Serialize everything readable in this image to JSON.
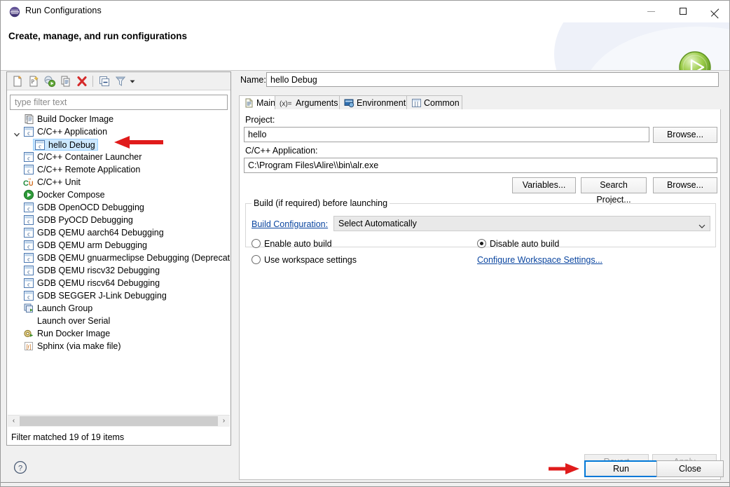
{
  "window": {
    "title": "Run Configurations",
    "icon": "eclipse-icon",
    "minimize_label": "Minimize",
    "maximize_label": "Maximize",
    "close_label": "Close"
  },
  "banner": {
    "title": "Create, manage, and run configurations",
    "badge_icon": "run-green-play-icon"
  },
  "left_panel": {
    "toolbar": [
      {
        "name": "new-launch-configuration-icon",
        "title": "New launch configuration"
      },
      {
        "name": "new-prototype-icon",
        "title": "New prototype"
      },
      {
        "name": "export-icon",
        "title": "Export"
      },
      {
        "name": "duplicate-icon",
        "title": "Duplicate"
      },
      {
        "name": "delete-icon",
        "title": "Delete"
      },
      {
        "name": "collapse-all-icon",
        "title": "Collapse All"
      },
      {
        "name": "filter-icon",
        "title": "Filter launch configurations"
      },
      {
        "name": "view-menu-icon",
        "title": "View Menu"
      }
    ],
    "filter": {
      "placeholder": "type filter text",
      "value": ""
    },
    "tree": [
      {
        "label": "Build Docker Image",
        "icon": "docker-build-icon",
        "indent": 1,
        "selected": false,
        "expander": ""
      },
      {
        "label": "C/C++ Application",
        "icon": "c-file-icon",
        "indent": 1,
        "selected": false,
        "expander": "expanded"
      },
      {
        "label": "hello Debug",
        "icon": "c-file-icon",
        "indent": 2,
        "selected": true,
        "expander": ""
      },
      {
        "label": "C/C++ Container Launcher",
        "icon": "c-file-icon",
        "indent": 1,
        "selected": false,
        "expander": ""
      },
      {
        "label": "C/C++ Remote Application",
        "icon": "c-file-icon",
        "indent": 1,
        "selected": false,
        "expander": ""
      },
      {
        "label": "C/C++ Unit",
        "icon": "cunit-icon",
        "indent": 1,
        "selected": false,
        "expander": ""
      },
      {
        "label": "Docker Compose",
        "icon": "docker-compose-icon",
        "indent": 1,
        "selected": false,
        "expander": ""
      },
      {
        "label": "GDB OpenOCD Debugging",
        "icon": "c-file-icon",
        "indent": 1,
        "selected": false,
        "expander": ""
      },
      {
        "label": "GDB PyOCD Debugging",
        "icon": "c-file-icon",
        "indent": 1,
        "selected": false,
        "expander": ""
      },
      {
        "label": "GDB QEMU aarch64 Debugging",
        "icon": "c-file-icon",
        "indent": 1,
        "selected": false,
        "expander": ""
      },
      {
        "label": "GDB QEMU arm Debugging",
        "icon": "c-file-icon",
        "indent": 1,
        "selected": false,
        "expander": ""
      },
      {
        "label": "GDB QEMU gnuarmeclipse Debugging (Deprecated)",
        "icon": "c-file-icon",
        "indent": 1,
        "selected": false,
        "expander": ""
      },
      {
        "label": "GDB QEMU riscv32 Debugging",
        "icon": "c-file-icon",
        "indent": 1,
        "selected": false,
        "expander": ""
      },
      {
        "label": "GDB QEMU riscv64 Debugging",
        "icon": "c-file-icon",
        "indent": 1,
        "selected": false,
        "expander": ""
      },
      {
        "label": "GDB SEGGER J-Link Debugging",
        "icon": "c-file-icon",
        "indent": 1,
        "selected": false,
        "expander": ""
      },
      {
        "label": "Launch Group",
        "icon": "launch-group-icon",
        "indent": 1,
        "selected": false,
        "expander": ""
      },
      {
        "label": "Launch over Serial",
        "icon": "none",
        "indent": 1,
        "selected": false,
        "expander": ""
      },
      {
        "label": "Run Docker Image",
        "icon": "docker-run-icon",
        "indent": 1,
        "selected": false,
        "expander": ""
      },
      {
        "label": "Sphinx (via make file)",
        "icon": "sphinx-icon",
        "indent": 1,
        "selected": false,
        "expander": ""
      }
    ],
    "scroll_left_glyph": "‹",
    "scroll_right_glyph": "›",
    "status": "Filter matched 19 of 19 items"
  },
  "right_panel": {
    "name_label": "Name:",
    "name_value": "hello Debug",
    "tabs": [
      {
        "label": "Main",
        "icon": "document-icon",
        "active": true
      },
      {
        "label": "Arguments",
        "icon": "arguments-icon",
        "active": false
      },
      {
        "label": "Environment",
        "icon": "environment-icon",
        "active": false
      },
      {
        "label": "Common",
        "icon": "common-icon",
        "active": false
      }
    ],
    "main_tab": {
      "project_label": "Project:",
      "project_value": "hello",
      "project_browse_label": "Browse...",
      "application_label": "C/C++ Application:",
      "application_value": "C:\\Program Files\\Alire\\\\bin\\alr.exe",
      "variables_label": "Variables...",
      "search_project_label": "Search Project...",
      "app_browse_label": "Browse...",
      "build_group_title": "Build (if required) before launching",
      "build_configuration_link": "Build Configuration:",
      "build_configuration_value": "Select Automatically",
      "enable_auto_build_label": "Enable auto build",
      "disable_auto_build_label": "Disable auto build",
      "use_workspace_settings_label": "Use workspace settings",
      "configure_workspace_link": "Configure Workspace Settings...",
      "selected_radio": "disable_auto_build"
    },
    "revert_label": "Revert",
    "apply_label": "Apply",
    "revert_enabled": false,
    "apply_enabled": false
  },
  "footer": {
    "help_label": "?",
    "run_label": "Run",
    "close_label": "Close"
  },
  "annotations": [
    {
      "name": "arrow-to-hello-debug",
      "direction": "left"
    },
    {
      "name": "arrow-to-run-button",
      "direction": "right"
    }
  ],
  "colors": {
    "accent": "#0078d7",
    "selection": "#cce8ff",
    "link": "#0b46a0",
    "annotation_red": "#e01b1b",
    "window_bg": "#f0f0f0"
  }
}
